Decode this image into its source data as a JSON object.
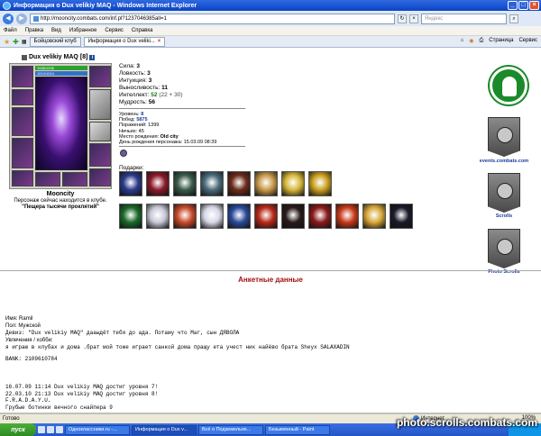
{
  "window": {
    "title": "Информация о Dux velikiy MAQ - Windows Internet Explorer",
    "minimize": "_",
    "maximize": "□",
    "close": "×"
  },
  "address": {
    "url": "http://mooncity.combats.com/inf.pl?1237046385all=1",
    "search_placeholder": "Яндекс"
  },
  "menu": [
    "Файл",
    "Правка",
    "Вид",
    "Избранное",
    "Сервис",
    "Справка"
  ],
  "tabs": [
    {
      "label": "Бойцовский клуб",
      "active": false
    },
    {
      "label": "Информация о Dux veliki...",
      "active": true
    }
  ],
  "tab_tools": {
    "page": "Страница",
    "tools": "Сервис"
  },
  "character": {
    "name": "Dux velikiy MAQ",
    "level": "[8]",
    "hp": "1536/1536",
    "mp": "1014/1014",
    "city": "Mooncity",
    "location": "Персонаж сейчас находится в клубе.",
    "room": "\"Пещера тысячи проклятий\""
  },
  "stats": [
    {
      "label": "Сила:",
      "value": "3"
    },
    {
      "label": "Ловкость:",
      "value": "3"
    },
    {
      "label": "Интуиция:",
      "value": "3"
    },
    {
      "label": "Выносливость:",
      "value": "11"
    },
    {
      "label": "Интеллект:",
      "value": "52",
      "mod": "(22 + 30)"
    },
    {
      "label": "Мудрость:",
      "value": "56"
    }
  ],
  "info": {
    "level_label": "Уровень:",
    "level": "8",
    "wins_label": "Побед:",
    "wins": "5875",
    "losses": "Поражений: 1399",
    "draws": "Ничьих: 45",
    "birthplace_label": "Место рождения:",
    "birthplace": "Old city",
    "birthday": "День рождения персонажа: 15.03.09 08:39"
  },
  "gifts_label": "Подарки:",
  "gifts_row1_colors": [
    "#2a3a8a",
    "#8a1a2a",
    "#3a5a4a",
    "#4a6a7a",
    "#6a2a1a",
    "#c89a4a",
    "#d8b838",
    "#caa020"
  ],
  "gifts_row2_colors": [
    "#1a6a2a",
    "#c8c8d8",
    "#c84a2a",
    "#d8d8e8",
    "#2a4a9a",
    "#b82a1a",
    "#2a1a1a",
    "#8a1a1a",
    "#c83a1a",
    "#d8a83a",
    "#1a1a2a"
  ],
  "sidebar": {
    "events_label": "events.combats.com",
    "scrolls_label": "Scrolls",
    "photo_label": "Photo Scrolls"
  },
  "questionnaire": {
    "title": "Анкетные данные",
    "name": "Имя: Ramil",
    "gender": "Пол: Мужской",
    "motto": "Девиз: \"Dux velikiy MAQ\" дааыдёт тебя до ада. Потаму что Маг, сын ДЯВОЛА",
    "hobbies_label": "Увлечения / хобби:",
    "hobbies": "я играю в клубах и дома .брат мой тоже играет санкой дома пращу ета учест   ник найёво брата   Sheyx SALAXADIN",
    "bank": "BANK: 2109610784"
  },
  "log": [
    "16.07.09 11:14 Dux velikiy MAQ достиг уровня 7!",
    "22.03.10 21:13 Dux velikiy MAQ достиг уровня 8!",
    "F.R.A.D.A.Y.U.",
    "Грубые ботинки вечного снайпера  9"
  ],
  "status": {
    "left": "Готово",
    "zone": "Интернет",
    "zoom": "100%"
  },
  "taskbar": {
    "start": "пуск",
    "tasks": [
      {
        "label": "Одноклассники.ru -...",
        "active": false
      },
      {
        "label": "Информация о Dux v...",
        "active": true
      },
      {
        "label": "Всё о Подземельях...",
        "active": false
      },
      {
        "label": "Безымянный - Paint",
        "active": false
      }
    ]
  },
  "watermark": "photo.scrolls.combats.com"
}
